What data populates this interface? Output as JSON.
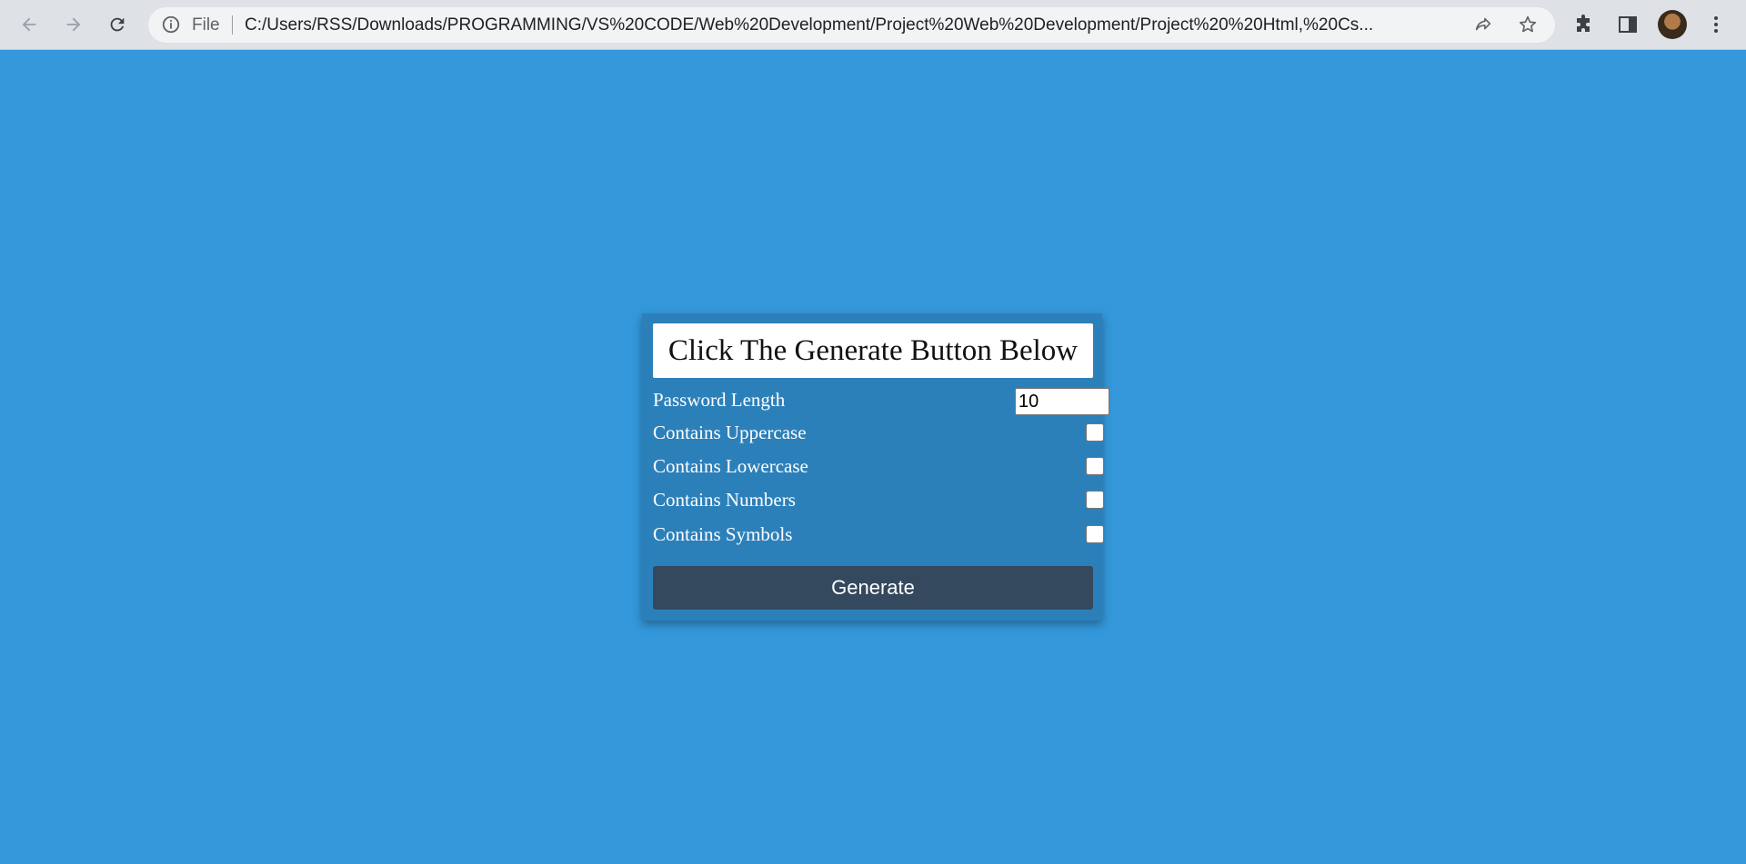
{
  "browser": {
    "omnibox_scheme": "File",
    "url": "C:/Users/RSS/Downloads/PROGRAMMING/VS%20CODE/Web%20Development/Project%20Web%20Development/Project%20%20Html,%20Cs...",
    "icons": [
      "back-arrow-icon",
      "forward-arrow-icon",
      "reload-icon",
      "info-icon",
      "share-icon",
      "star-icon",
      "puzzle-extensions-icon",
      "side-panel-icon",
      "avatar",
      "kebab-menu-icon"
    ]
  },
  "generator": {
    "result_text": "Click The Generate Button Below",
    "fields": [
      {
        "label": "Password Length",
        "type": "number",
        "value": "10"
      },
      {
        "label": "Contains Uppercase",
        "type": "checkbox",
        "checked": false
      },
      {
        "label": "Contains Lowercase",
        "type": "checkbox",
        "checked": false
      },
      {
        "label": "Contains Numbers",
        "type": "checkbox",
        "checked": false
      },
      {
        "label": "Contains Symbols",
        "type": "checkbox",
        "checked": false
      }
    ],
    "generate_label": "Generate"
  },
  "colors": {
    "page_background": "#3498db",
    "card_background": "#2c80ba",
    "button_background": "#34495e"
  }
}
